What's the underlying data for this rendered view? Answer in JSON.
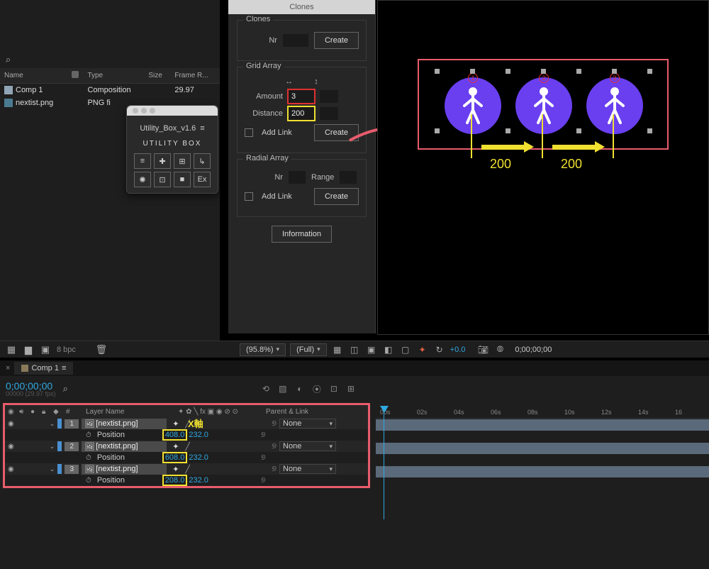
{
  "project": {
    "search_placeholder": "",
    "columns": [
      "Name",
      "",
      "Type",
      "Size",
      "Frame R..."
    ],
    "rows": [
      {
        "icon": "comp",
        "name": "Comp 1",
        "type": "Composition",
        "size": "",
        "rate": "29.97"
      },
      {
        "icon": "png",
        "name": "nextist.png",
        "type": "PNG fi",
        "size": "",
        "rate": ""
      }
    ]
  },
  "utility": {
    "title": "Utility_Box_v1.6",
    "logo": "UTILITY BOX",
    "buttons": [
      "≡",
      "✚",
      "⊞",
      "↳",
      "✺",
      "⊡",
      "■",
      "Ex"
    ]
  },
  "clones": {
    "title": "Clones",
    "sections": {
      "clones": {
        "legend": "Clones",
        "nr_label": "Nr",
        "nr": "",
        "create": "Create"
      },
      "grid": {
        "legend": "Grid Array",
        "amount_label": "Amount",
        "amount": "3",
        "distance_label": "Distance",
        "distance": "200",
        "addlink": "Add Link",
        "create": "Create"
      },
      "radial": {
        "legend": "Radial Array",
        "nr_label": "Nr",
        "nr": "",
        "range_label": "Range",
        "range": "",
        "addlink": "Add Link",
        "create": "Create"
      }
    },
    "info_btn": "Information"
  },
  "preview": {
    "clone_labels": [
      "1",
      "2",
      "3"
    ],
    "dist_label_1": "200",
    "dist_label_2": "200"
  },
  "footer": {
    "bpc": "8 bpc"
  },
  "preview_footer": {
    "zoom": "(95.8%)",
    "res": "(Full)",
    "exposure": "+0.0",
    "timecode": "0;00;00;00"
  },
  "timeline": {
    "tab": "Comp 1",
    "timecode": "0;00;00;00",
    "timecode_sub": "00000 (29.97 fps)",
    "col_layer_name": "Layer Name",
    "col_parent": "Parent & Link",
    "x_axis_label": "X軸",
    "ruler": [
      "00s",
      "02s",
      "04s",
      "06s",
      "08s",
      "10s",
      "12s",
      "14s",
      "16"
    ],
    "layers": [
      {
        "idx": "1",
        "name": "[nextist.png]",
        "prop": "Position",
        "x": "408.0",
        "y": "232.0",
        "parent": "None"
      },
      {
        "idx": "2",
        "name": "[nextist.png]",
        "prop": "Position",
        "x": "608.0",
        "y": "232.0",
        "parent": "None"
      },
      {
        "idx": "3",
        "name": "[nextist.png]",
        "prop": "Position",
        "x": "208.0",
        "y": "232.0",
        "parent": "None"
      }
    ]
  }
}
